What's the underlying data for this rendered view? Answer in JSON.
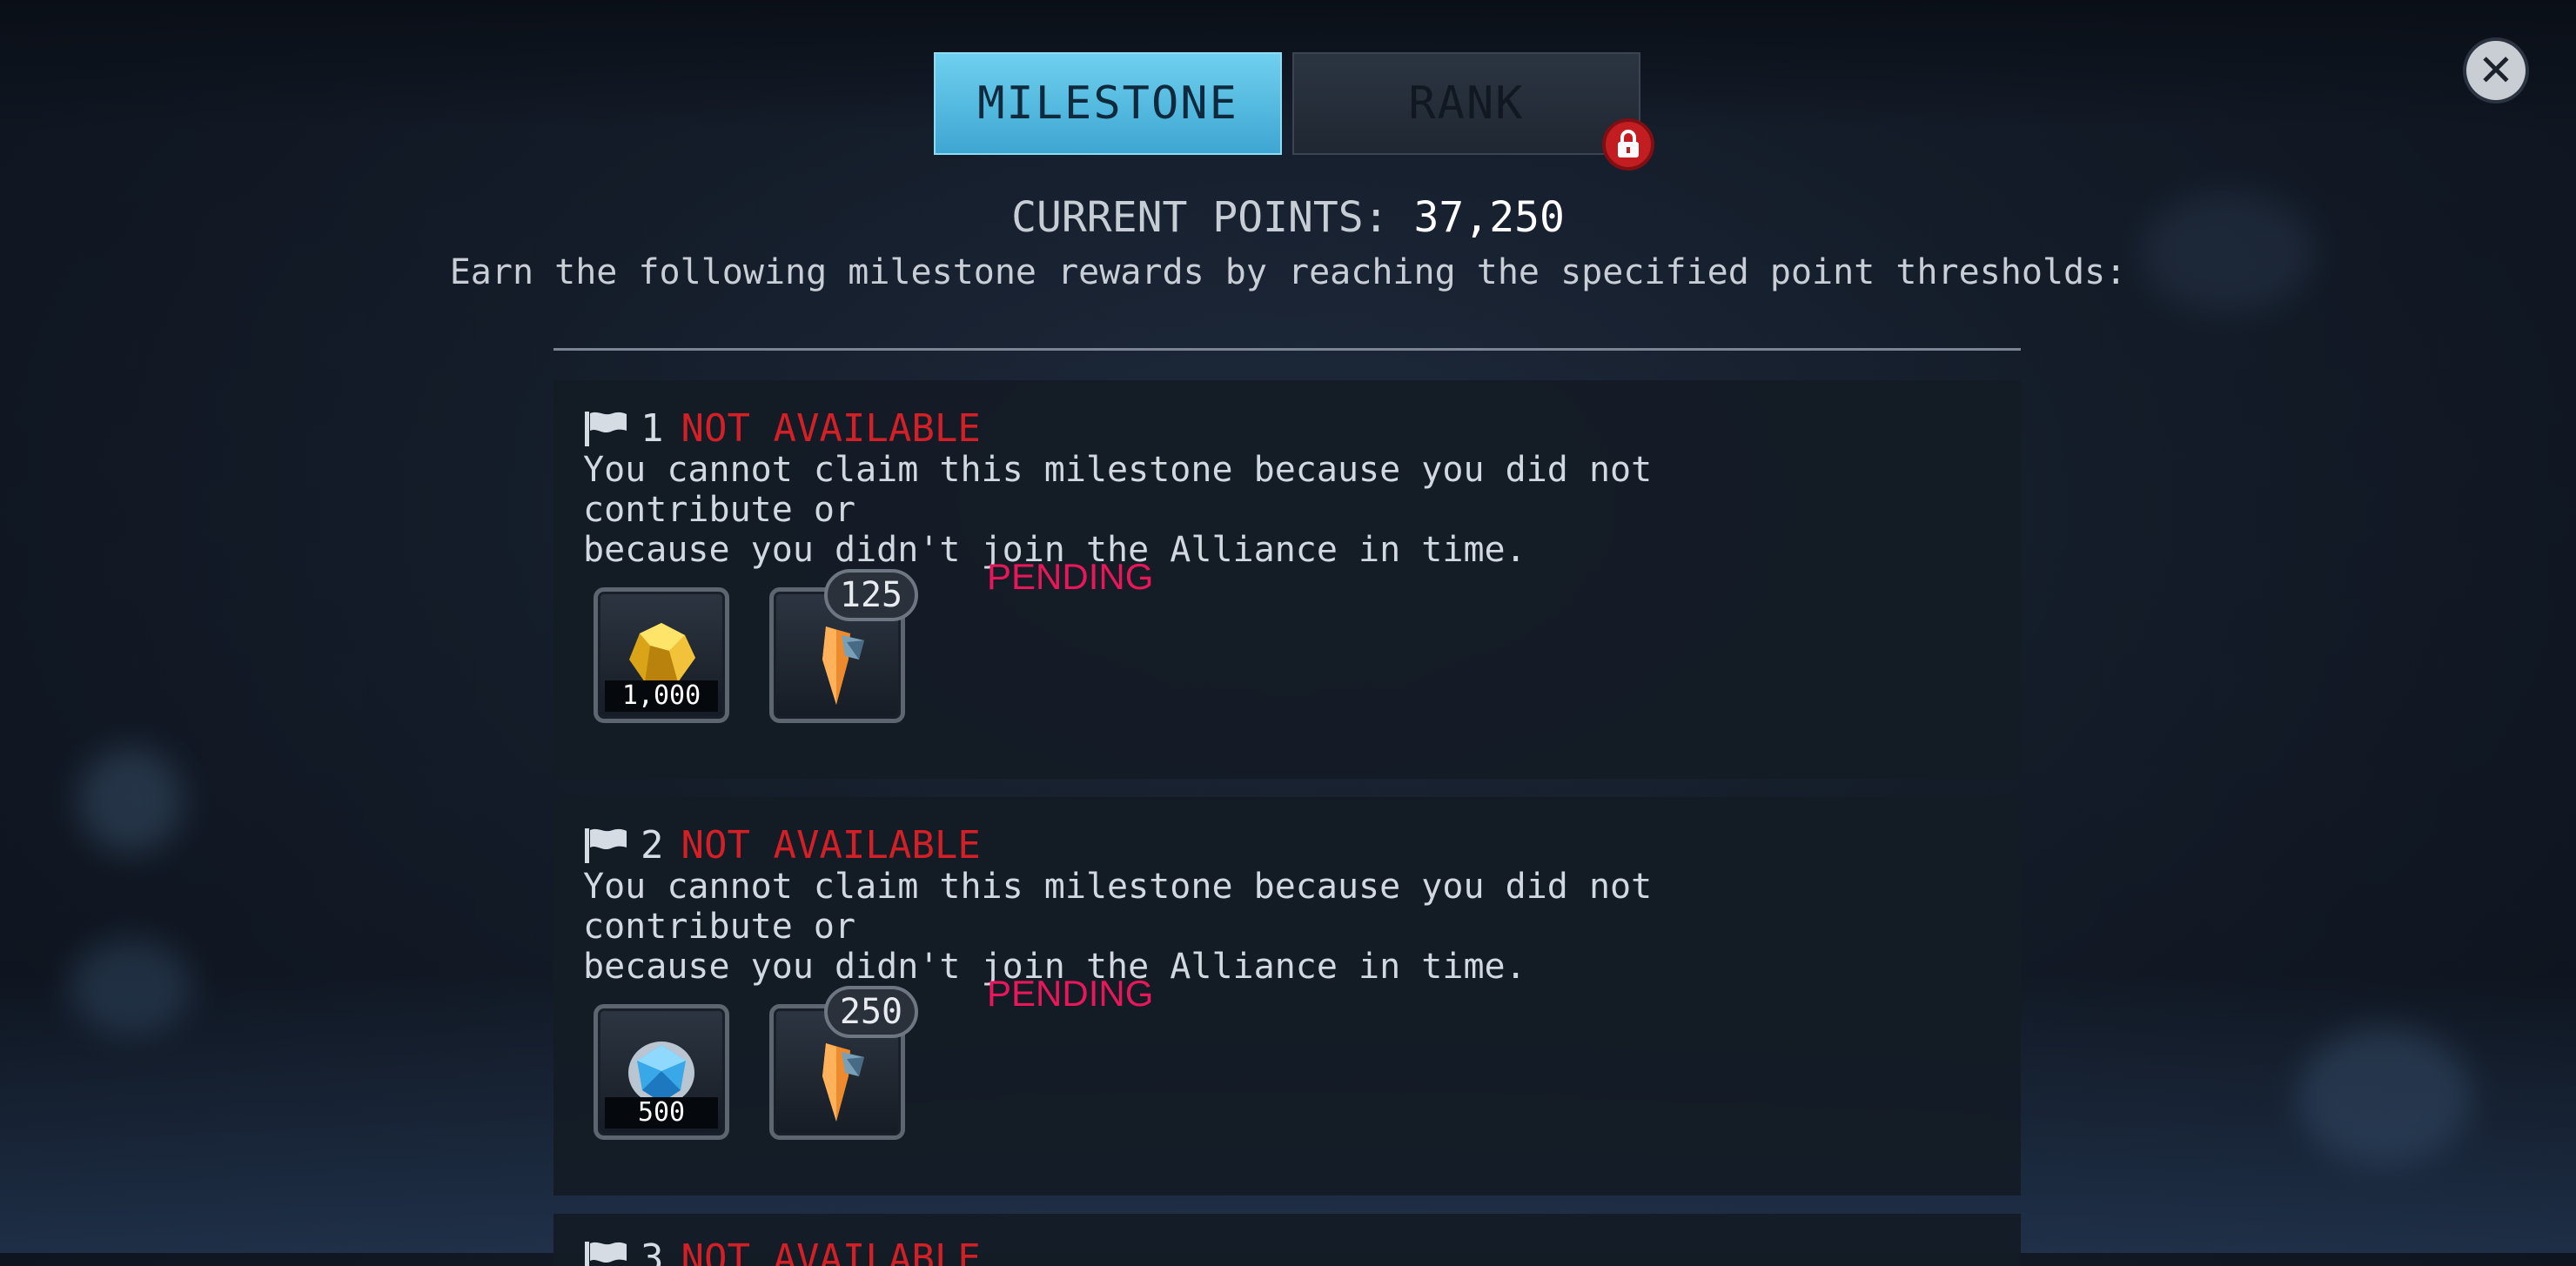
{
  "tabs": {
    "milestone_label": "MILESTONE",
    "rank_label": "RANK"
  },
  "points": {
    "label": "CURRENT POINTS:",
    "value": "37,250"
  },
  "subtitle": "Earn the following milestone rewards by reaching the specified point thresholds:",
  "milestones": [
    {
      "number": "1",
      "status": "NOT AVAILABLE",
      "description_line1": "You cannot claim this milestone because you did not contribute or",
      "description_line2": "because you didn't join the Alliance in time.",
      "pending": "PENDING",
      "rewards": [
        {
          "icon": "gold-ore-icon",
          "amount": "1,000"
        },
        {
          "icon": "crystal-shard-icon",
          "badge": "125"
        }
      ]
    },
    {
      "number": "2",
      "status": "NOT AVAILABLE",
      "description_line1": "You cannot claim this milestone because you did not contribute or",
      "description_line2": "because you didn't join the Alliance in time.",
      "pending": "PENDING",
      "rewards": [
        {
          "icon": "blue-gem-icon",
          "amount": "500"
        },
        {
          "icon": "crystal-shard-icon",
          "badge": "250"
        }
      ]
    },
    {
      "number": "3",
      "status": "NOT AVAILABLE"
    }
  ],
  "colors": {
    "status_red": "#d31f26",
    "pending_pink": "#e8175a",
    "tab_active": "#4fb6dd"
  }
}
